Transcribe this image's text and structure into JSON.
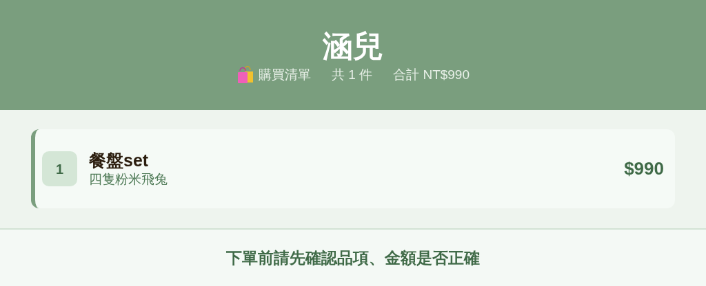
{
  "header": {
    "title": "涵兒",
    "subtitle": [
      "購買清單",
      "共 1 件",
      "合計 NT$990"
    ]
  },
  "items": [
    {
      "number": "1",
      "name": "餐盤set",
      "variant": "四隻粉米飛兔",
      "price": "$990"
    }
  ],
  "footer": {
    "note": "下單前請先確認品項、金額是否正確"
  }
}
